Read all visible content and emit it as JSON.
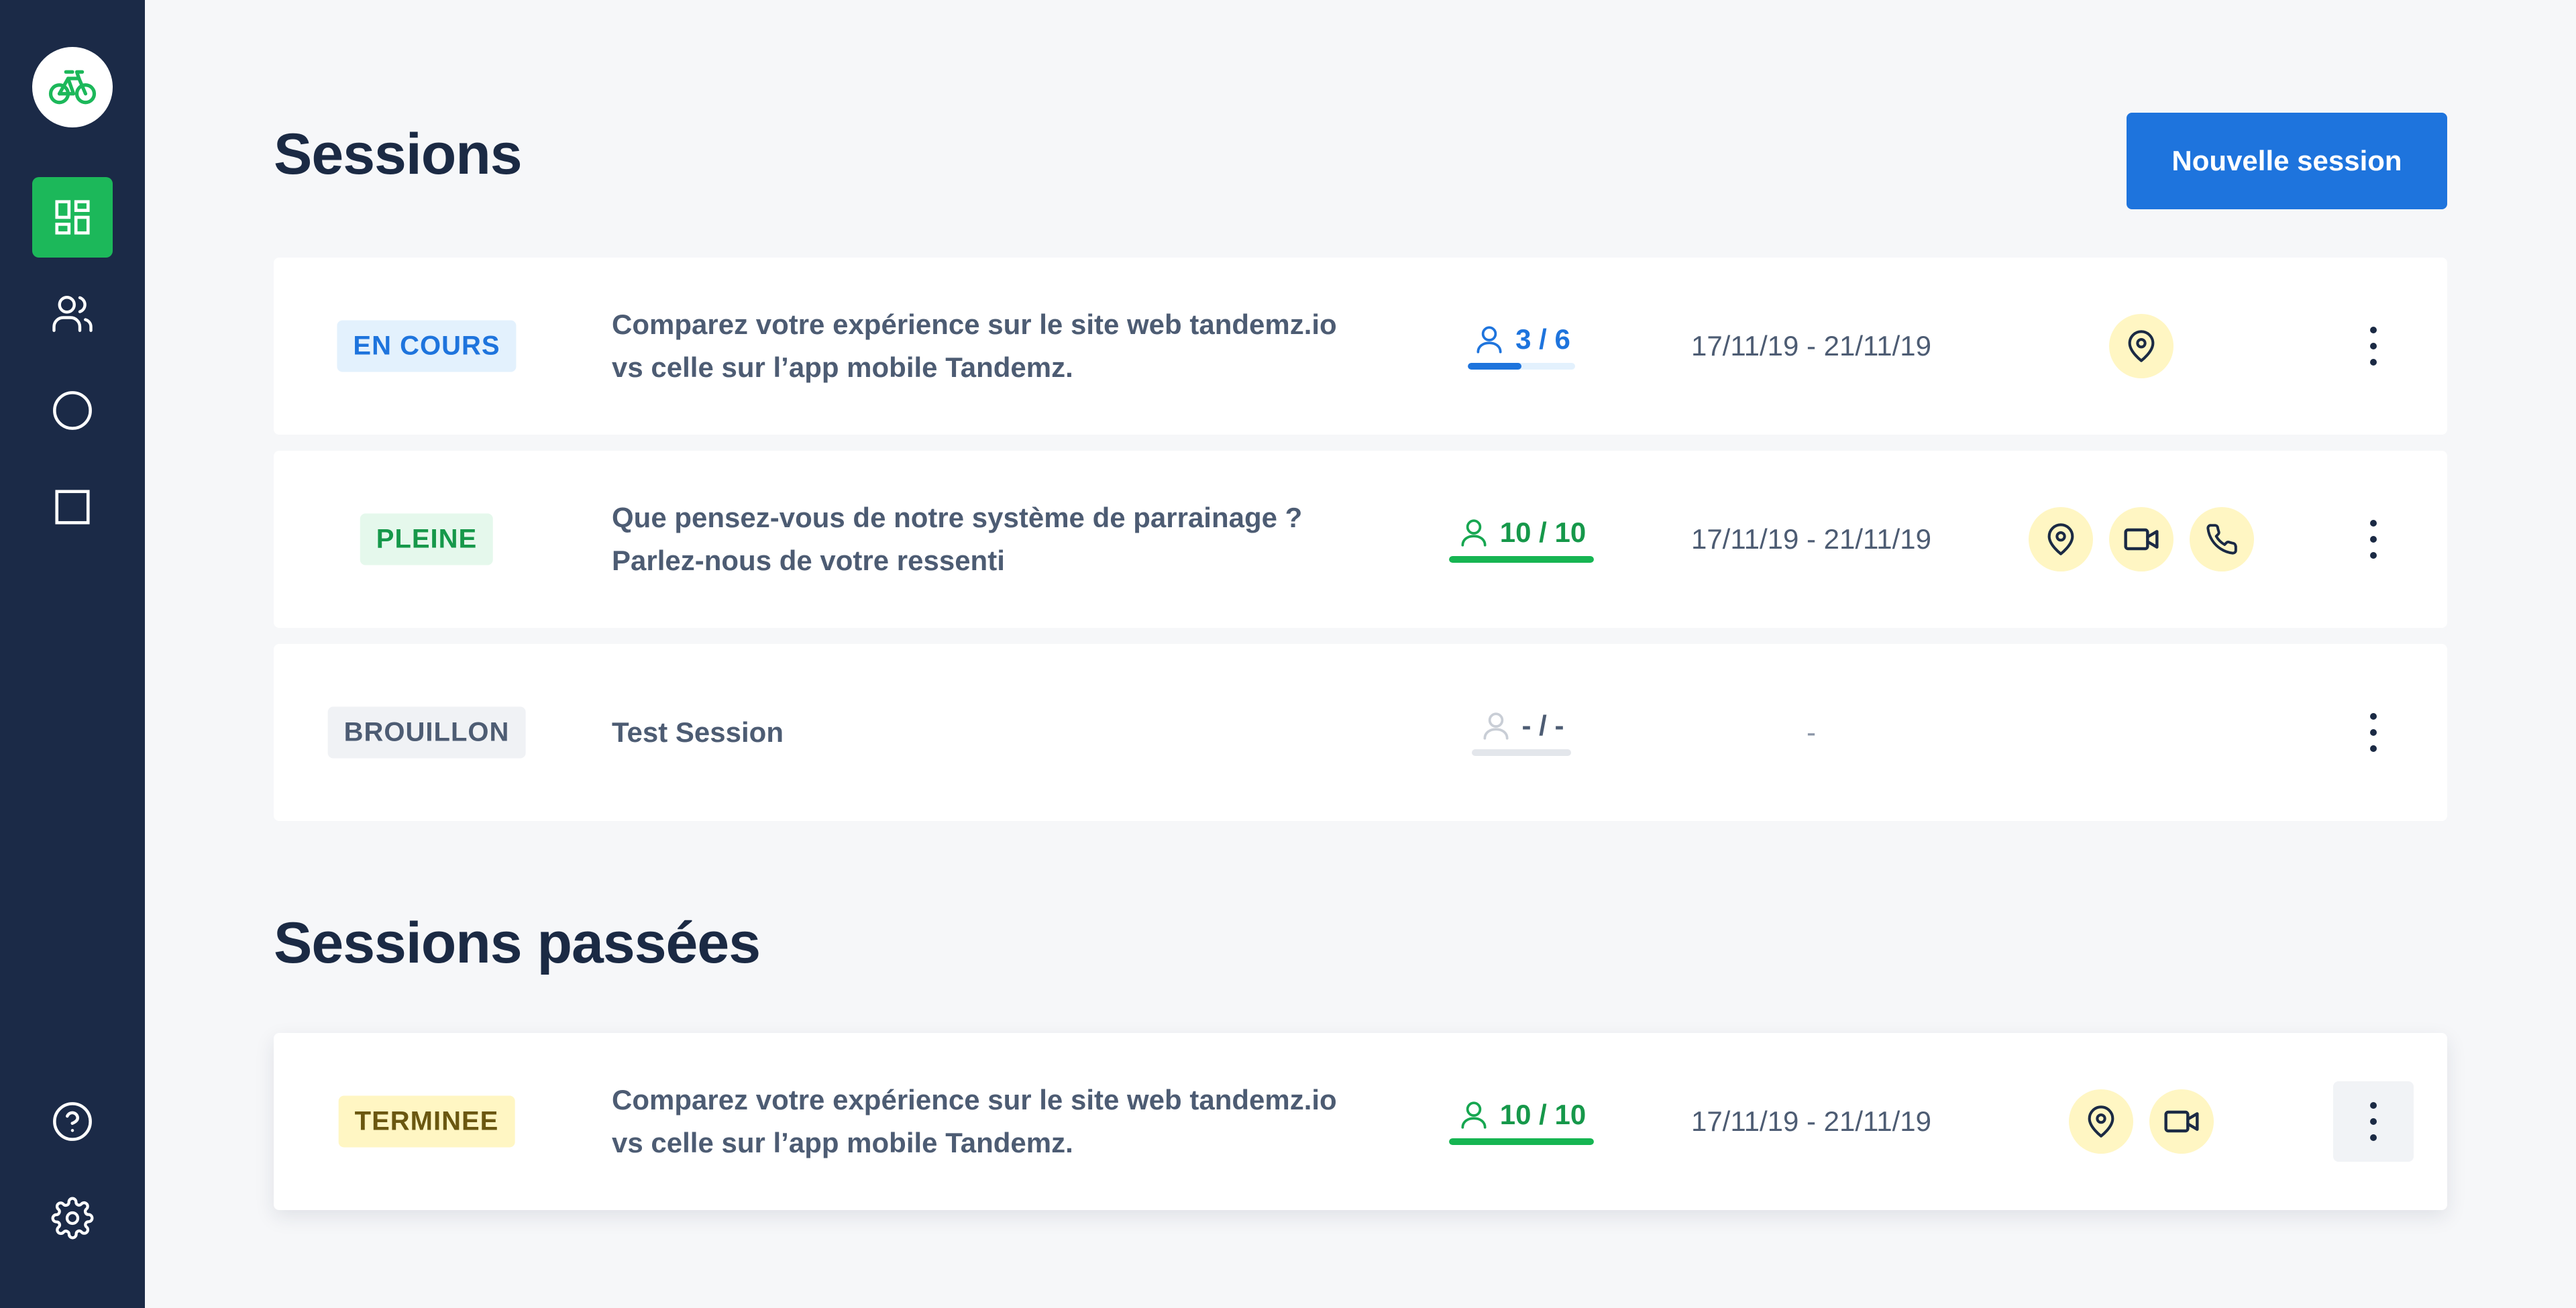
{
  "sidebar": {
    "logo_icon": "bicycle-icon",
    "items": [
      {
        "icon": "dashboard-icon",
        "active": true
      },
      {
        "icon": "users-icon",
        "active": false
      },
      {
        "icon": "circle-icon",
        "active": false
      },
      {
        "icon": "square-icon",
        "active": false
      }
    ],
    "bottom_items": [
      {
        "icon": "help-icon"
      },
      {
        "icon": "settings-icon"
      }
    ]
  },
  "main": {
    "title": "Sessions",
    "new_session_label": "Nouvelle session",
    "past_title": "Sessions passées"
  },
  "sessions": [
    {
      "status": "EN COURS",
      "title_line1": "Comparez votre expérience sur le site web tandemz.io",
      "title_line2": "vs celle sur l’app mobile Tandemz.",
      "capacity": "3 / 6",
      "capacity_fraction": 0.5,
      "dates": "17/11/19 - 21/11/19",
      "modes": [
        "location-icon"
      ]
    },
    {
      "status": "PLEINE",
      "title_line1": "Que pensez-vous de notre système de parrainage ?",
      "title_line2": "Parlez-nous de votre ressenti",
      "capacity": "10 / 10",
      "capacity_fraction": 1.0,
      "dates": "17/11/19 - 21/11/19",
      "modes": [
        "location-icon",
        "video-icon",
        "phone-icon"
      ]
    },
    {
      "status": "BROUILLON",
      "title_line1": "Test Session",
      "title_line2": "",
      "capacity": "- / -",
      "capacity_fraction": 0,
      "dates": "-",
      "modes": []
    }
  ],
  "past_sessions": [
    {
      "status": "TERMINEE",
      "title_line1": "Comparez votre expérience sur le site web tandemz.io",
      "title_line2": "vs celle sur l’app mobile Tandemz.",
      "capacity": "10 / 10",
      "capacity_fraction": 1.0,
      "dates": "17/11/19 - 21/11/19",
      "modes": [
        "location-icon",
        "video-icon"
      ]
    }
  ],
  "colors": {
    "sidebar": "#1b2a47",
    "accent_green": "#1cb85a",
    "primary_blue": "#1e74dd",
    "mode_bg": "#fff6c3"
  }
}
